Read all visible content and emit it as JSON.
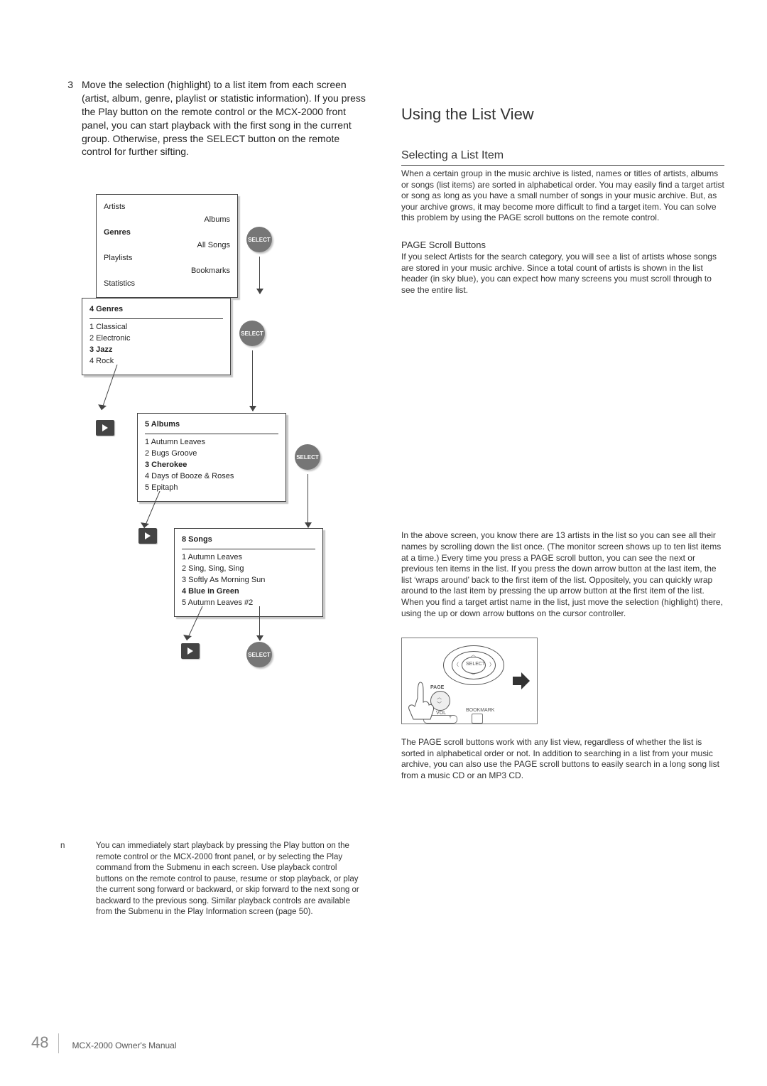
{
  "step": {
    "num": "3",
    "text": "Move the selection (highlight) to a list item from each screen (artist, album, genre, playlist or statistic information). If you press the Play button on the remote control or the MCX-2000 front panel, you can start playback with the ﬁrst song in the current group. Otherwise, press the SELECT button on the remote control for further sifting."
  },
  "diagram": {
    "select_label": "SELECT",
    "box_top": {
      "left": [
        "Artists",
        "Genres",
        "Playlists",
        "Statistics"
      ],
      "right": [
        "Albums",
        "All Songs",
        "Bookmarks"
      ],
      "selected": "Genres"
    },
    "box_genres": {
      "header": "4 Genres",
      "items": [
        "1 Classical",
        "2 Electronic",
        "3 Jazz",
        "4 Rock"
      ],
      "selected": "3 Jazz"
    },
    "box_albums": {
      "header": "5 Albums",
      "items": [
        "1 Autumn Leaves",
        "2 Bugs Groove",
        "3 Cherokee",
        "4 Days of Booze & Roses",
        "5 Epitaph"
      ],
      "selected": "3 Cherokee"
    },
    "box_songs": {
      "header": "8 Songs",
      "items": [
        "1 Autumn Leaves",
        "2 Sing, Sing, Sing",
        "3 Softly As Morning Sun",
        "4 Blue in Green",
        "5 Autumn Leaves #2"
      ],
      "selected": "4 Blue in Green"
    }
  },
  "note": {
    "bullet": "n",
    "text": "You can immediately start playback by pressing the Play button on the remote control or the MCX-2000 front panel, or by selecting the Play command from the Submenu in each screen. Use playback control buttons on the remote control to pause, resume or stop playback, or play the current song forward or backward, or skip forward to the next song or backward to the previous song. Similar playback controls are available from the Submenu in the Play Information screen (page 50)."
  },
  "right": {
    "heading": "Using the List View",
    "subheading": "Selecting a List Item",
    "p1": "When a certain group in the music archive is listed, names or titles of artists, albums or songs (list items) are sorted in alphabetical order. You may easily ﬁnd a target artist or song as long as you have a small number of songs in your music archive. But, as your archive grows, it may become more difﬁcult to ﬁnd a target item. You can solve this problem by using the PAGE scroll buttons on the remote control.",
    "page_scroll_title": "PAGE Scroll Buttons",
    "p2": "If you select Artists for the search category, you will see a list of artists whose songs are stored in your music archive. Since a total count of artists is shown in the list header (in sky blue), you can expect how many screens you must scroll through to see the entire list.",
    "p3": "In the above screen, you know there are 13 artists in the list so you can see all their names by scrolling down the list once. (The monitor screen shows up to ten list items at a time.) Every time you press a PAGE scroll button, you can see the next or previous ten items in the list. If you press the down arrow button at the last item, the list ‘wraps around’ back to the ﬁrst item of the list. Oppositely, you can quickly wrap around to the last item by pressing the up arrow button at the ﬁrst item of the list. When you ﬁnd a target artist name in the list, just move the selection (highlight) there, using the up or down arrow buttons on the cursor controller.",
    "p4": "The PAGE scroll buttons work with any list view, regardless of whether the list is sorted in alphabetical order or not. In addition to searching in a list from your music archive, you can also use the PAGE scroll buttons to easily search in a long song list from a music CD or an MP3 CD.",
    "remote_labels": {
      "select": "SELECT",
      "page": "PAGE",
      "vol": "VOL",
      "bookmark": "BOOKMARK"
    }
  },
  "footer": {
    "page": "48",
    "title": "MCX-2000 Owner's Manual"
  }
}
